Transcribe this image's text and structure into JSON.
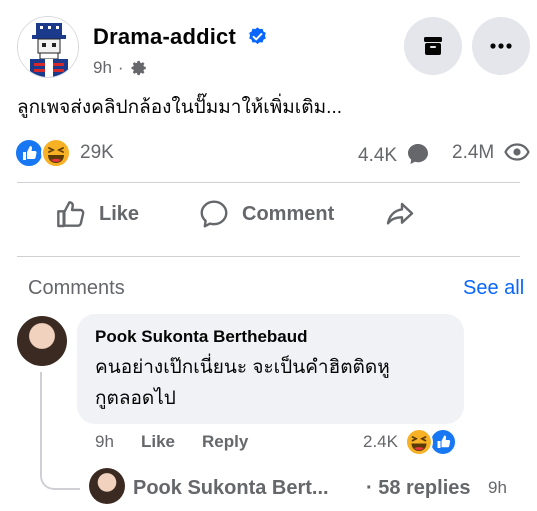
{
  "post": {
    "page_name": "Drama-addict",
    "time": "9h",
    "dot": "·",
    "text": "ลูกเพจส่งคลิปกล้องในปั๊มมาให้เพิ่มเติม...",
    "reactions_count": "29K",
    "comments_count": "4.4K",
    "views_count": "2.4M",
    "icons": {
      "verified": "verified-badge-icon",
      "privacy": "gear-icon",
      "archive": "archive-icon",
      "more": "more-icon",
      "reactions": [
        "like-icon",
        "haha-icon"
      ],
      "comments": "comment-bubble-icon",
      "views": "eye-icon"
    }
  },
  "actions": {
    "like_label": "Like",
    "comment_label": "Comment"
  },
  "comments_section": {
    "label": "Comments",
    "see_all": "See all"
  },
  "comment": {
    "author": "Pook Sukonta Berthebaud",
    "text_line1": "คนอย่างเป๊กเนี่ยนะ จะเป็นคำฮิตติดหู",
    "text_line2": "กูตลอดไป",
    "time": "9h",
    "like_label": "Like",
    "reply_label": "Reply",
    "reactions_count": "2.4K"
  },
  "reply_preview": {
    "author_truncated": "Pook Sukonta Bert...",
    "replies_label": "· 58 replies",
    "time": "9h"
  },
  "colors": {
    "link_blue": "#0866ff",
    "muted_gray": "#65676b",
    "bubble_bg": "#f0f2f5",
    "button_bg": "#e4e6eb"
  }
}
